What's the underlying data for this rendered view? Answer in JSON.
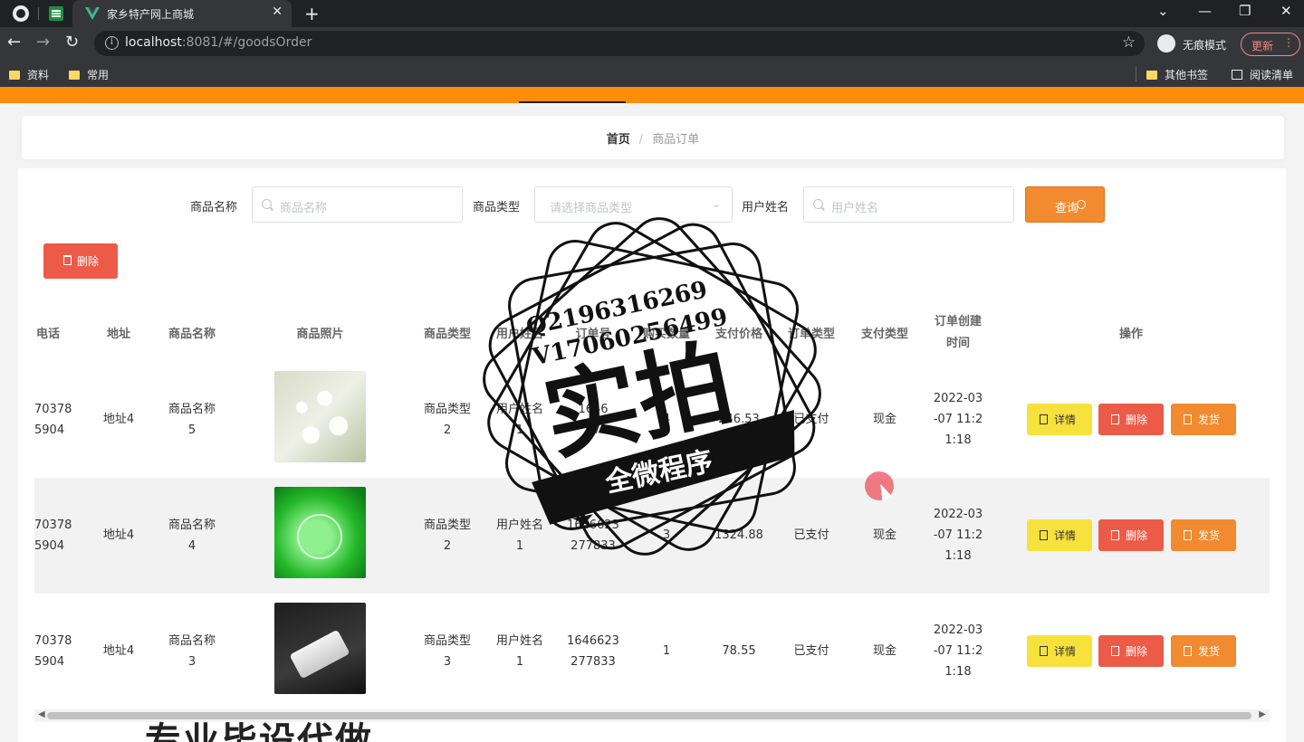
{
  "browser": {
    "tab_title": "家乡特产网上商城",
    "url_host": "localhost",
    "url_rest": ":8081/#/goodsOrder",
    "incognito_label": "无痕模式",
    "update_label": "更新",
    "bookmarks": [
      "资料",
      "常用"
    ],
    "bookmarks_right": [
      "其他书签",
      "阅读清单"
    ]
  },
  "breadcrumb": {
    "home": "首页",
    "separator": "/",
    "current": "商品订单"
  },
  "filters": {
    "goods_name_label": "商品名称",
    "goods_name_placeholder": "商品名称",
    "goods_type_label": "商品类型",
    "goods_type_placeholder": "请选择商品类型",
    "user_name_label": "用户姓名",
    "user_name_placeholder": "用户姓名",
    "query_label": "查询"
  },
  "toolbar": {
    "delete_label": "删除"
  },
  "table": {
    "headers": {
      "phone": "电话",
      "address": "地址",
      "goods_name": "商品名称",
      "goods_photo": "商品照片",
      "goods_type": "商品类型",
      "user_name": "用户姓名",
      "order_no": "订单号",
      "quantity": "购买数量",
      "price": "支付价格",
      "order_type": "订单类型",
      "pay_type": "支付类型",
      "created_l1": "订单创建",
      "created_l2": "时间",
      "actions": "操作"
    },
    "rows": [
      {
        "phone_l1": "70378",
        "phone_l2": "5904",
        "address": "地址4",
        "goods_l1": "商品名称",
        "goods_l2": "5",
        "type_l1": "商品类型",
        "type_l2": "2",
        "user_l1": "用户姓名",
        "user_l2": "1",
        "order_l1": "1646",
        "order_l2": "27",
        "quantity": "4",
        "price": "246.53",
        "order_type": "已支付",
        "pay_type": "现金",
        "time_l1": "2022-03",
        "time_l2": "-07 11:2",
        "time_l3": "1:18"
      },
      {
        "phone_l1": "70378",
        "phone_l2": "5904",
        "address": "地址4",
        "goods_l1": "商品名称",
        "goods_l2": "4",
        "type_l1": "商品类型",
        "type_l2": "2",
        "user_l1": "用户姓名",
        "user_l2": "1",
        "order_l1": "1646623",
        "order_l2": "277833",
        "quantity": "3",
        "price": "1324.88",
        "order_type": "已支付",
        "pay_type": "现金",
        "time_l1": "2022-03",
        "time_l2": "-07 11:2",
        "time_l3": "1:18"
      },
      {
        "phone_l1": "70378",
        "phone_l2": "5904",
        "address": "地址4",
        "goods_l1": "商品名称",
        "goods_l2": "3",
        "type_l1": "商品类型",
        "type_l2": "3",
        "user_l1": "用户姓名",
        "user_l2": "1",
        "order_l1": "1646623",
        "order_l2": "277833",
        "quantity": "1",
        "price": "78.55",
        "order_type": "已支付",
        "pay_type": "现金",
        "time_l1": "2022-03",
        "time_l2": "-07 11:2",
        "time_l3": "1:18"
      }
    ],
    "action_labels": {
      "detail": "详情",
      "delete": "删除",
      "ship": "发货"
    }
  },
  "watermark": {
    "line1": "Q2196316269",
    "line2": "V17060256499",
    "big": "实拍",
    "ribbon": "全微程序"
  },
  "caption": "专业毕设代做",
  "colors": {
    "orange_header": "#fd8c0a",
    "query_button": "#f28a2f",
    "delete_button": "#ec5b48",
    "detail_button": "#f7e23d",
    "ship_button": "#f28a2f"
  }
}
